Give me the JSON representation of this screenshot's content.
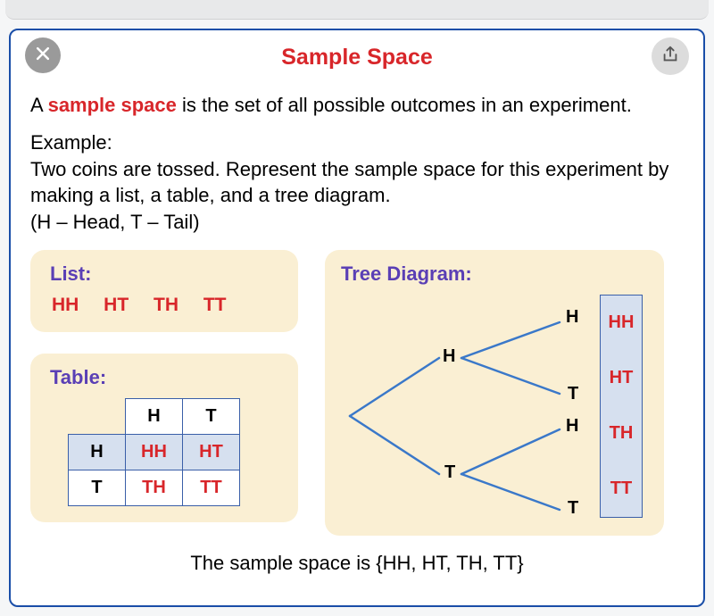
{
  "title": "Sample Space",
  "definition_term": "sample space",
  "definition_prefix": "A ",
  "definition_suffix": " is the set of all possible outcomes in an experiment.",
  "example_label": "Example:",
  "example_text": "Two coins are tossed. Represent the sample space for this experiment by making a list, a table, and a tree diagram.",
  "legend": "(H – Head, T – Tail)",
  "list": {
    "label": "List:",
    "items": "HH   HT   TH   TT"
  },
  "table": {
    "label": "Table:",
    "col_h": "H",
    "col_t": "T",
    "row_h": "H",
    "row_t": "T",
    "hh": "HH",
    "ht": "HT",
    "th": "TH",
    "tt": "TT"
  },
  "tree": {
    "label": "Tree Diagram:",
    "n1_h": "H",
    "n1_t": "T",
    "n2_hh": "H",
    "n2_ht": "T",
    "n2_th": "H",
    "n2_tt": "T",
    "out_hh": "HH",
    "out_ht": "HT",
    "out_th": "TH",
    "out_tt": "TT"
  },
  "conclusion": "The sample space is {HH, HT, TH, TT}"
}
